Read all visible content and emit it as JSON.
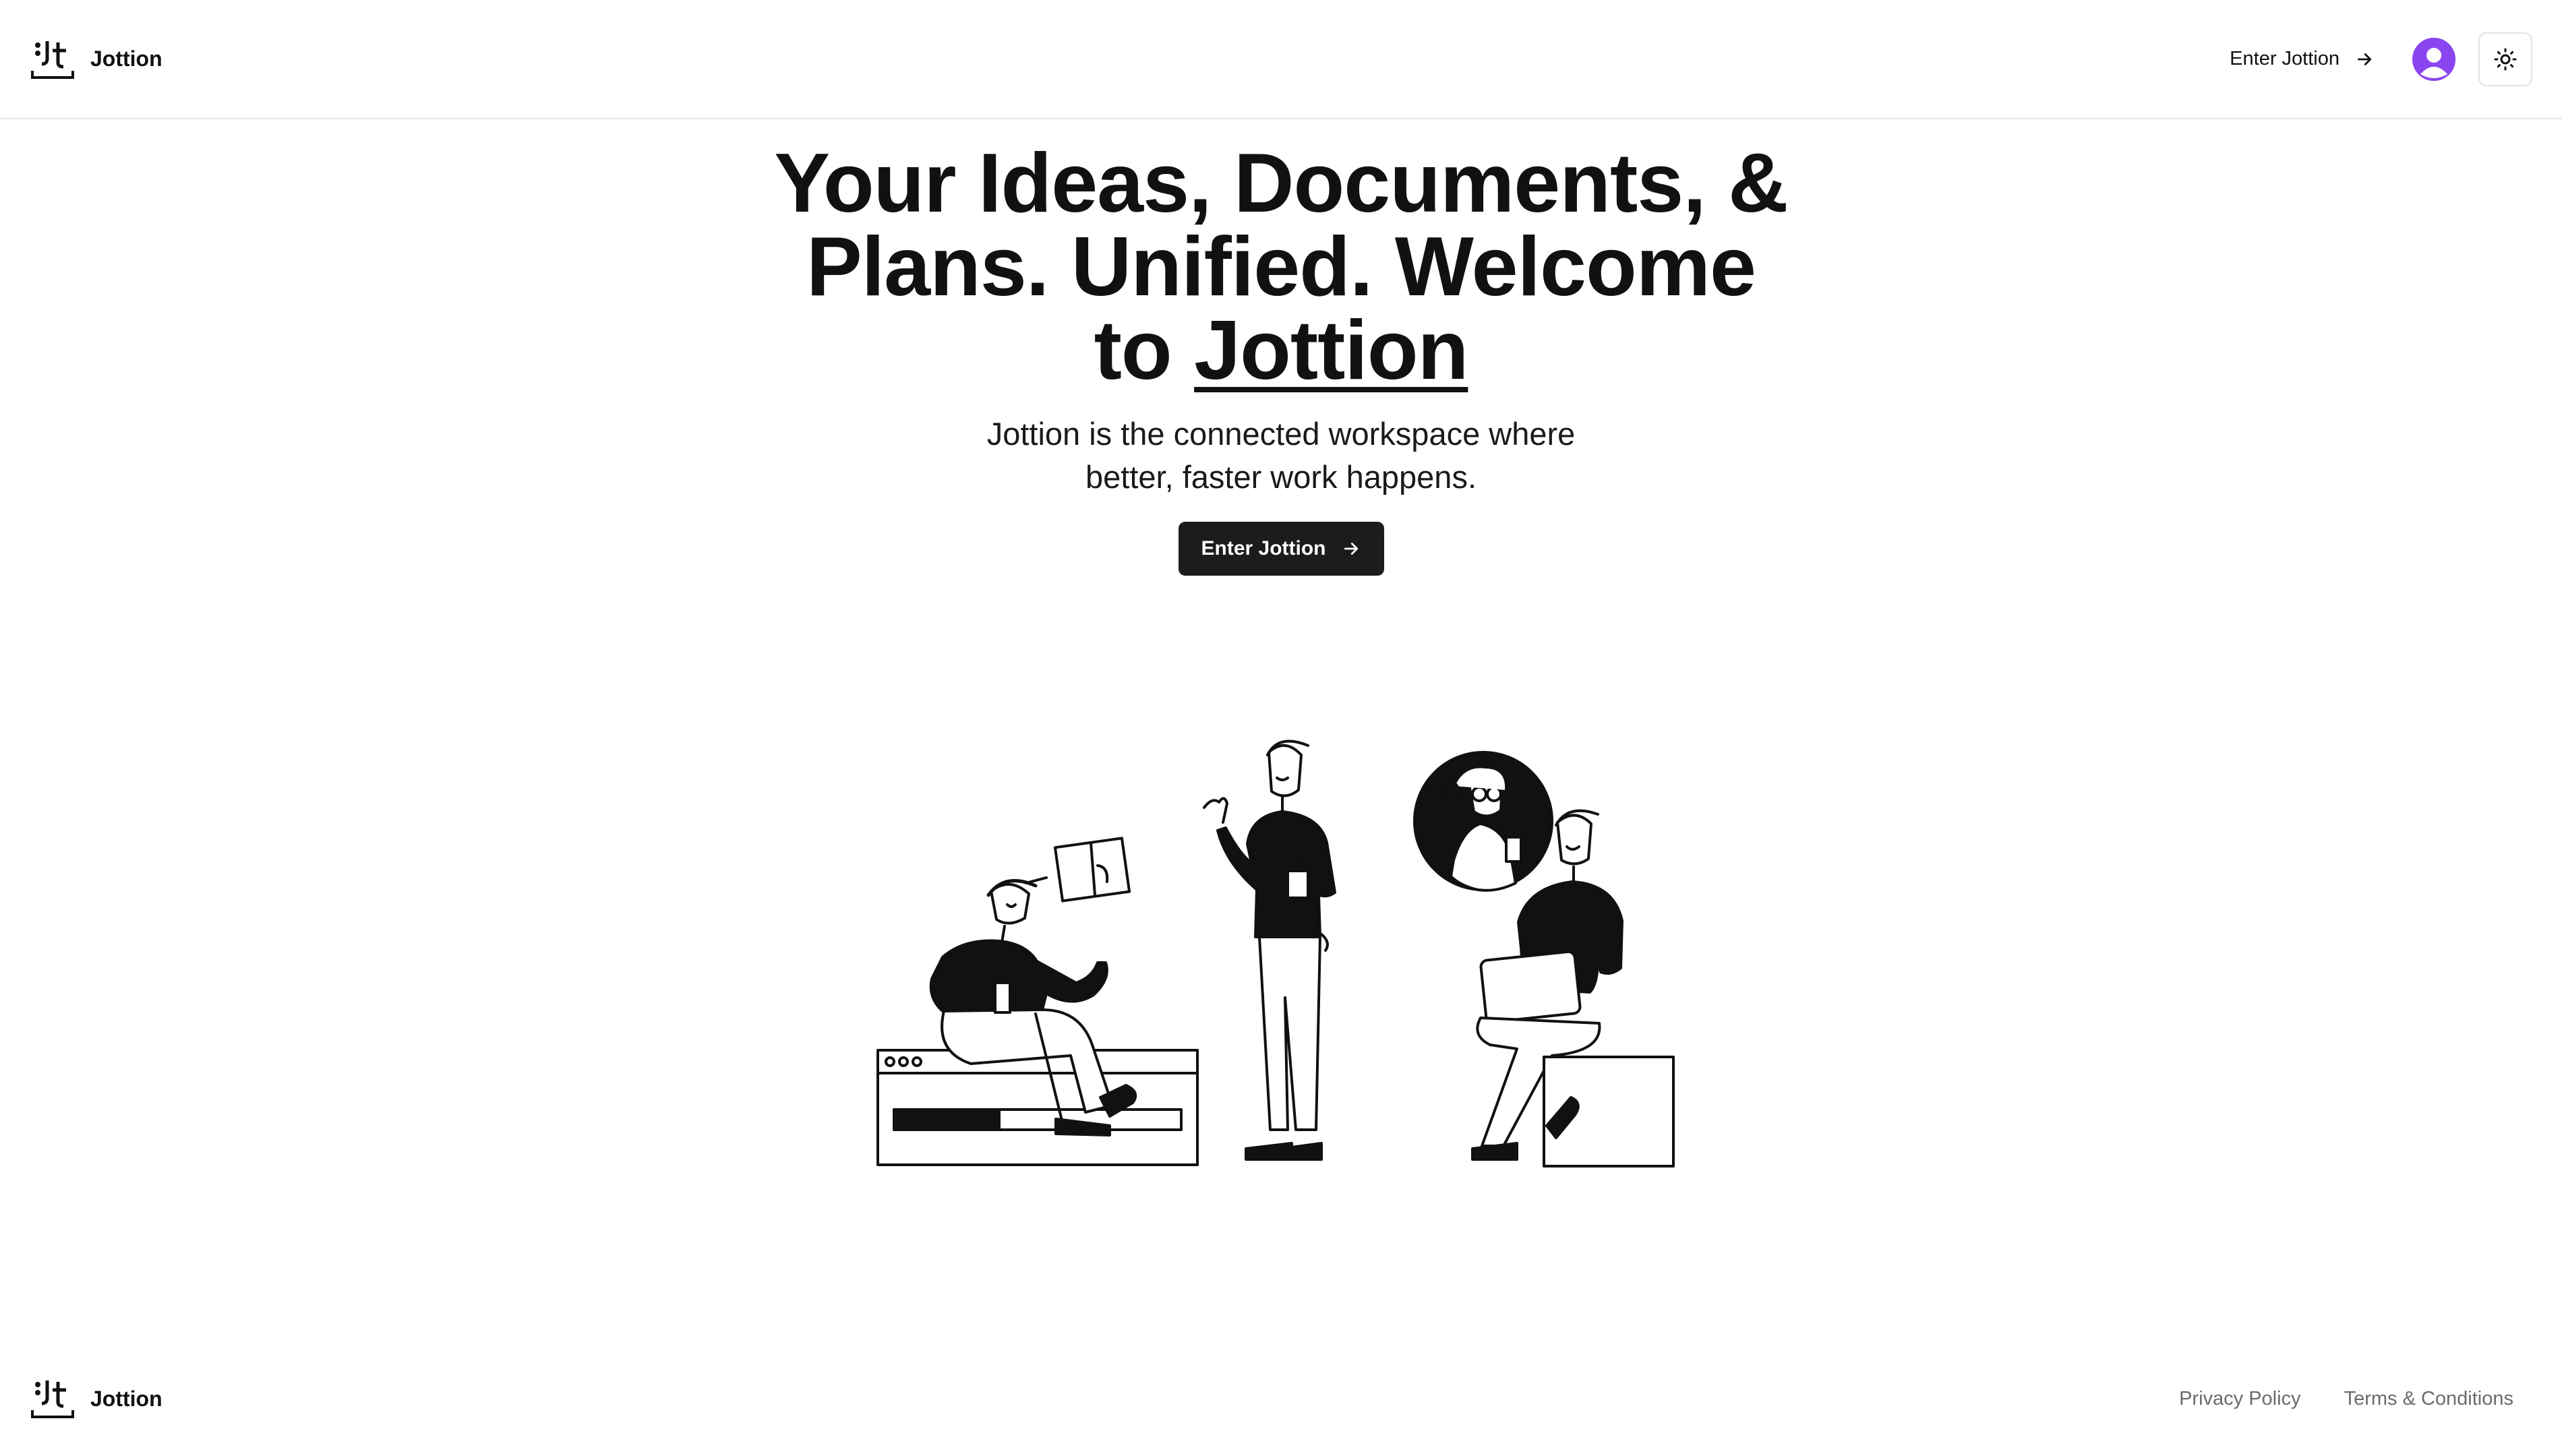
{
  "header": {
    "brand_name": "Jottion",
    "enter_label": "Enter Jottion",
    "icons": {
      "logo": "jottion-logo-icon",
      "arrow": "arrow-right-icon",
      "avatar": "user-avatar-icon",
      "theme": "sun-icon"
    }
  },
  "hero": {
    "title_line1": "Your Ideas, Documents, &",
    "title_line2": "Plans. Unified. Welcome",
    "title_to": "to ",
    "title_brand": "Jottion",
    "subtitle": "Jottion is the connected workspace where better, faster work happens.",
    "cta_label": "Enter Jottion"
  },
  "footer": {
    "brand_name": "Jottion",
    "links": [
      "Privacy Policy",
      "Terms & Conditions"
    ]
  },
  "colors": {
    "accent": "#7c3aed",
    "cta_background": "#1c1c1c",
    "footer_link": "#6b6b6b"
  }
}
